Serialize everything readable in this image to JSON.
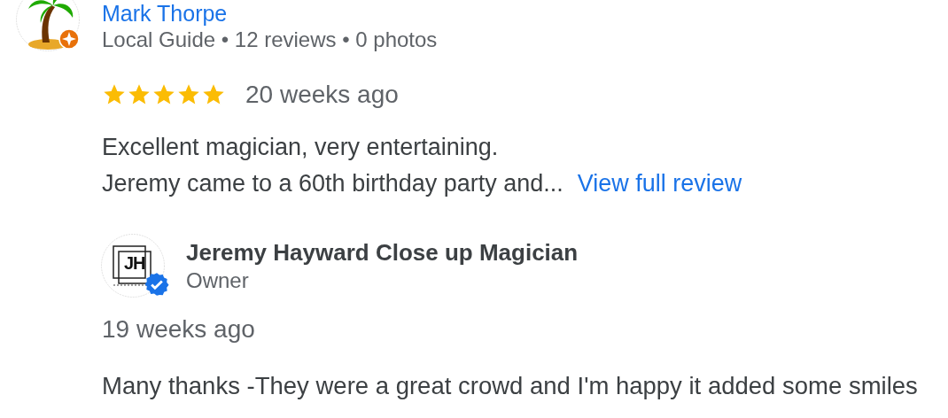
{
  "review": {
    "author": "Mark Thorpe",
    "author_meta": "Local Guide • 12 reviews • 0 photos",
    "local_guide": true,
    "stars": 5,
    "time": "20 weeks ago",
    "text_lines": [
      "Excellent magician, very entertaining.",
      "Jeremy came to a 60th birthday party and..."
    ],
    "link": "View full review"
  },
  "owner_reply": {
    "logo_text": "JH",
    "name": "Jeremy Hayward Close up Magician",
    "role": "Owner",
    "verified": true,
    "time": "19 weeks ago",
    "text": "Many thanks -They were a great crowd and I'm happy it added some smiles"
  }
}
